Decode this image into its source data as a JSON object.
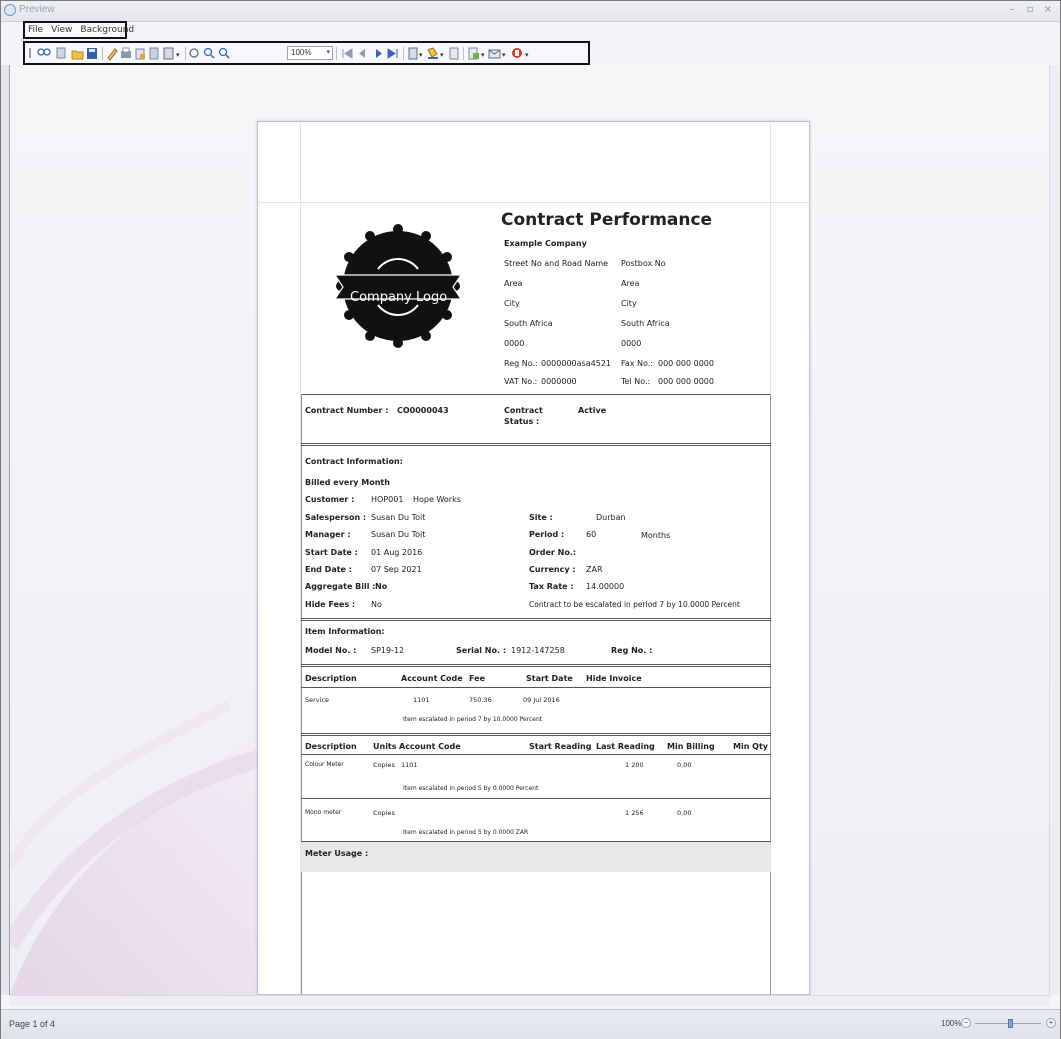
{
  "window": {
    "title": "Preview",
    "controls": [
      "–",
      "▫",
      "×"
    ]
  },
  "menu": {
    "items": [
      "File",
      "View",
      "Background"
    ]
  },
  "toolbar": {
    "zoom_value": "100%"
  },
  "status": {
    "page_info": "Page 1 of 4",
    "zoom_percent": "100%"
  },
  "report": {
    "title": "Contract Performance",
    "logo_text": "Company Logo",
    "company": {
      "name": "Example Company",
      "street": "Street No and Road Name",
      "postbox": "Postbox No",
      "area1": "Area",
      "area2": "Area",
      "city1": "City",
      "city2": "City",
      "country1": "South Africa",
      "country2": "South Africa",
      "code1": "0000",
      "code2": "0000",
      "reg_label": "Reg No.:",
      "reg_value": "0000000asa4521",
      "fax_label": "Fax No.:",
      "fax_value": "000 000 0000",
      "vat_label": "VAT No.:",
      "vat_value": "0000000",
      "tel_label": "Tel No.:",
      "tel_value": "000 000 0000"
    },
    "contract_number_label": "Contract Number :",
    "contract_number": "CO0000043",
    "contract_status_label1": "Contract",
    "contract_status_label2": "Status :",
    "contract_status": "Active",
    "info": {
      "heading": "Contract Information:",
      "billed": "Billed every Month",
      "customer_label": "Customer :",
      "customer_code": "HOP001",
      "customer_name": "Hope Works",
      "salesperson_label": "Salesperson :",
      "salesperson": "Susan Du Toit",
      "manager_label": "Manager :",
      "manager": "Susan Du Toit",
      "start_label": "Start Date :",
      "start": "01 Aug 2016",
      "end_label": "End Date :",
      "end": "07 Sep 2021",
      "aggregate_label": "Aggregate Bill :",
      "aggregate": "No",
      "hidefees_label": "Hide Fees :",
      "hidefees": "No",
      "site_label": "Site :",
      "site": "Durban",
      "period_label": "Period :",
      "period": "60",
      "period_unit": "Months",
      "order_label": "Order No.:",
      "currency_label": "Currency :",
      "currency": "ZAR",
      "tax_label": "Tax Rate :",
      "tax": "14.00000",
      "escalation": "Contract to be escalated in period 7 by 10.0000 Percent"
    },
    "item": {
      "heading": "Item Information:",
      "model_label": "Model No. :",
      "model": "SP19-12",
      "serial_label": "Serial No. :",
      "serial": "1912-147258",
      "reg_label": "Reg No. :"
    },
    "fees": {
      "headers": [
        "Description",
        "Account Code",
        "Fee",
        "Start Date",
        "Hide Invoice"
      ],
      "row": [
        "Service",
        "1101",
        "750.36",
        "09 Jul 2016"
      ],
      "note": "Item escalated in period 7 by 10.0000 Percent"
    },
    "meters": {
      "headers": [
        "Description",
        "Units",
        "Account Code",
        "Start Reading",
        "Last Reading",
        "Min Billing",
        "Min Qty"
      ],
      "rows": [
        {
          "desc": "Colour Meter",
          "units": "Copies",
          "code": "1101",
          "last": "1 200",
          "min": "0.00",
          "note": "Item escalated in period 5 by 0.0000 Percent"
        },
        {
          "desc": "Mono meter",
          "units": "Copies",
          "code": "",
          "last": "1 256",
          "min": "0.00",
          "note": "Item escalated in period 5 by 0.0000 ZAR"
        }
      ]
    },
    "meter_usage_label": "Meter Usage :"
  }
}
